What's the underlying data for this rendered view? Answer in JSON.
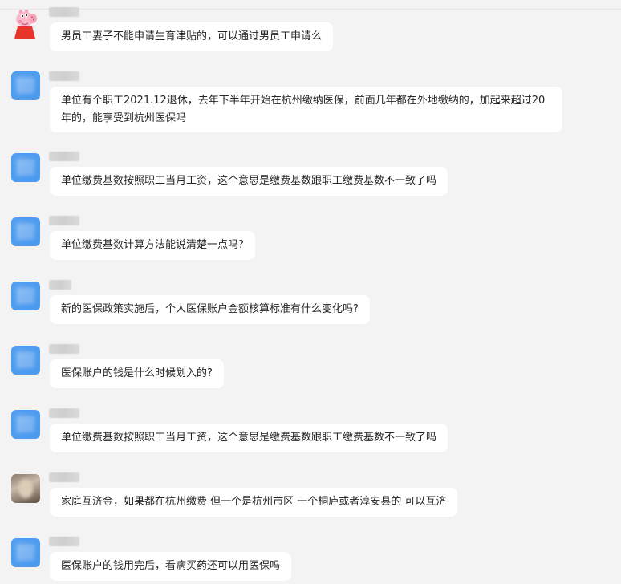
{
  "messages": [
    {
      "avatar": "peppa-pig-avatar",
      "text": "男员工妻子不能申请生育津贴的，可以通过男员工申请么"
    },
    {
      "avatar": "blurred-blue-avatar",
      "text": "单位有个职工2021.12退休，去年下半年开始在杭州缴纳医保，前面几年都在外地缴纳的，加起来超过20年的，能享受到杭州医保吗"
    },
    {
      "avatar": "blurred-blue-avatar",
      "text": "单位缴费基数按照职工当月工资，这个意思是缴费基数跟职工缴费基数不一致了吗"
    },
    {
      "avatar": "blurred-blue-avatar",
      "text": "单位缴费基数计算方法能说清楚一点吗?"
    },
    {
      "avatar": "blurred-blue-avatar",
      "text": "新的医保政策实施后，个人医保账户金额核算标准有什么变化吗?"
    },
    {
      "avatar": "blurred-blue-avatar",
      "text": "医保账户的钱是什么时候划入的?"
    },
    {
      "avatar": "blurred-blue-avatar",
      "text": "单位缴费基数按照职工当月工资，这个意思是缴费基数跟职工缴费基数不一致了吗"
    },
    {
      "avatar": "blurred-photo-avatar",
      "text": "家庭互济金，如果都在杭州缴费  但一个是杭州市区  一个桐庐或者淳安县的  可以互济"
    },
    {
      "avatar": "blurred-blue-avatar",
      "text": "医保账户的钱用完后，看病买药还可以用医保吗"
    }
  ]
}
